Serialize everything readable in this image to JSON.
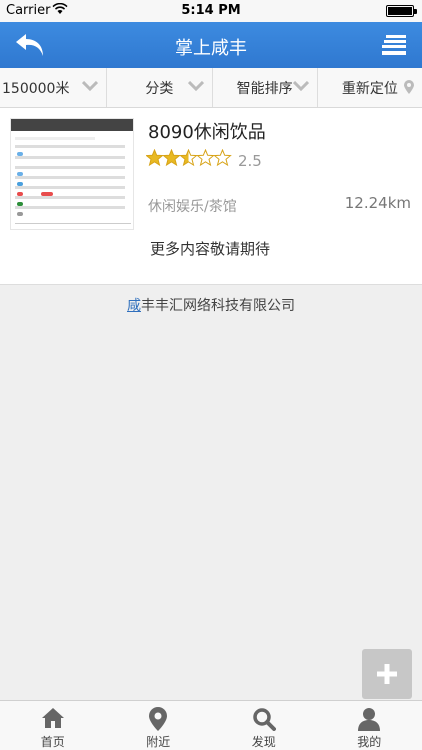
{
  "status_bar": {
    "carrier": "Carrier",
    "time": "5:14 PM"
  },
  "nav": {
    "title": "掌上咸丰"
  },
  "filters": [
    {
      "label": "150000米"
    },
    {
      "label": "分类"
    },
    {
      "label": "智能排序"
    },
    {
      "label": "重新定位"
    }
  ],
  "listing": {
    "title": "8090休闲饮品",
    "rating": "2.5",
    "rating_value": 2.5,
    "category": "休闲娱乐/茶馆",
    "distance": "12.24km",
    "more_text": "更多内容敬请期待"
  },
  "footer": {
    "first_char": "咸",
    "rest": "丰丰汇网络科技有限公司"
  },
  "tabs": [
    {
      "label": "首页",
      "icon": "home-icon"
    },
    {
      "label": "附近",
      "icon": "location-pin-icon"
    },
    {
      "label": "发现",
      "icon": "search-icon"
    },
    {
      "label": "我的",
      "icon": "user-icon"
    }
  ],
  "colors": {
    "nav_blue": "#2f78d0",
    "star_gold": "#e8b923"
  }
}
